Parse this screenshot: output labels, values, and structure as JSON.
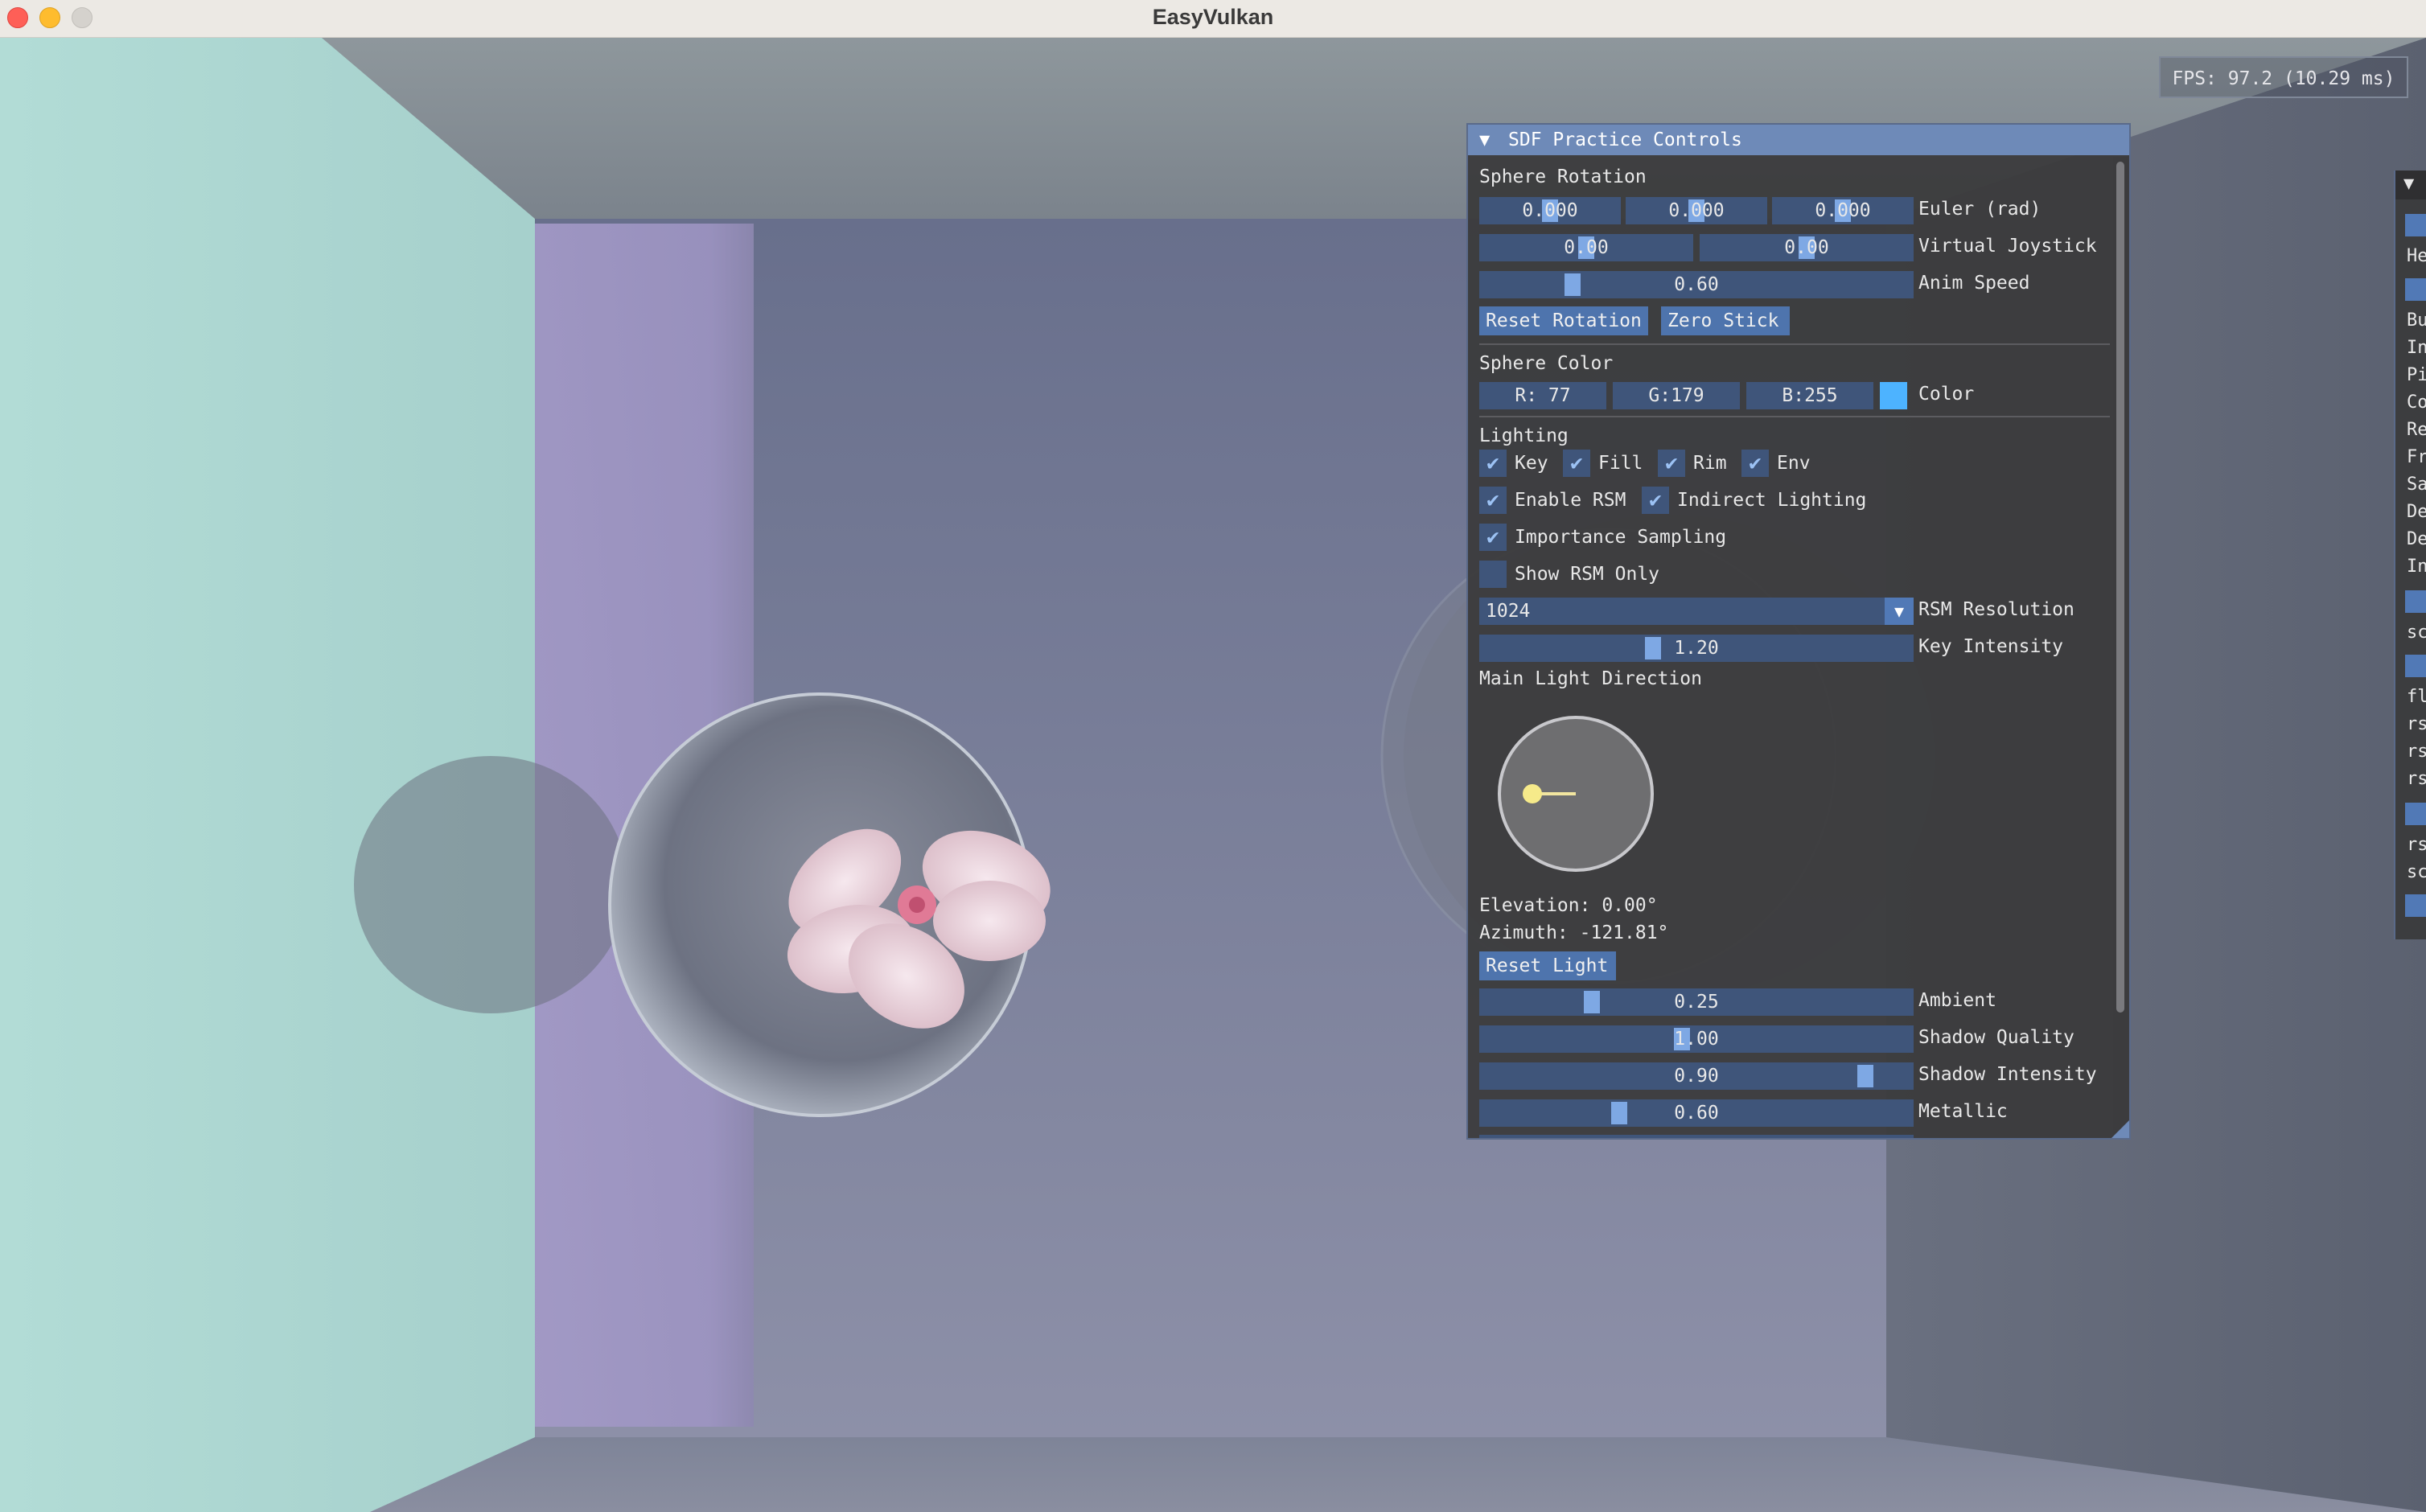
{
  "window": {
    "title": "EasyVulkan"
  },
  "overlay": {
    "fps": "FPS: 97.2 (10.29 ms)"
  },
  "panel": {
    "title": "SDF Practice Controls",
    "sphere_rotation": {
      "header": "Sphere Rotation",
      "euler": {
        "x": "0.000",
        "y": "0.000",
        "z": "0.000",
        "label": "Euler (rad)"
      },
      "joystick": {
        "x": "0.00",
        "y": "0.00",
        "label": "Virtual Joystick"
      },
      "anim_speed": {
        "value": "0.60",
        "label": "Anim Speed",
        "fraction": 0.2
      },
      "reset_rotation": "Reset Rotation",
      "zero_stick": "Zero Stick"
    },
    "sphere_color": {
      "header": "Sphere Color",
      "r": "R: 77",
      "g": "G:179",
      "b": "B:255",
      "label": "Color",
      "swatch_color": "#4db3ff"
    },
    "lighting": {
      "header": "Lighting",
      "key": "Key",
      "fill": "Fill",
      "rim": "Rim",
      "env": "Env",
      "enable_rsm": "Enable RSM",
      "indirect": "Indirect Lighting",
      "importance": "Importance Sampling",
      "show_rsm": "Show RSM Only",
      "rsm_resolution": {
        "value": "1024",
        "label": "RSM Resolution"
      },
      "key_intensity": {
        "value": "1.20",
        "label": "Key Intensity"
      },
      "main_light_direction": "Main Light Direction",
      "elevation": "Elevation: 0.00°",
      "azimuth": "Azimuth: -121.81°",
      "reset_light": "Reset Light",
      "ambient": {
        "value": "0.25",
        "label": "Ambient"
      },
      "shadow_quality": {
        "value": "1.00",
        "label": "Shadow Quality"
      },
      "shadow_intensity": {
        "value": "0.90",
        "label": "Shadow Intensity"
      },
      "metallic": {
        "value": "0.60",
        "label": "Metallic"
      }
    }
  },
  "right_panel": {
    "items": [
      "He",
      "Bu",
      "In",
      "Pi",
      "Co",
      "Re",
      "Fr",
      "Sa",
      "De",
      "De",
      "In",
      "sc",
      "fl",
      "rs",
      "rs",
      "rs",
      "rs",
      "sc"
    ]
  },
  "colors": {
    "accent": "#6e8ab8",
    "frame_bg": "#3f557a",
    "slider_grab": "#7ea8e4",
    "button": "#4e74ad"
  }
}
